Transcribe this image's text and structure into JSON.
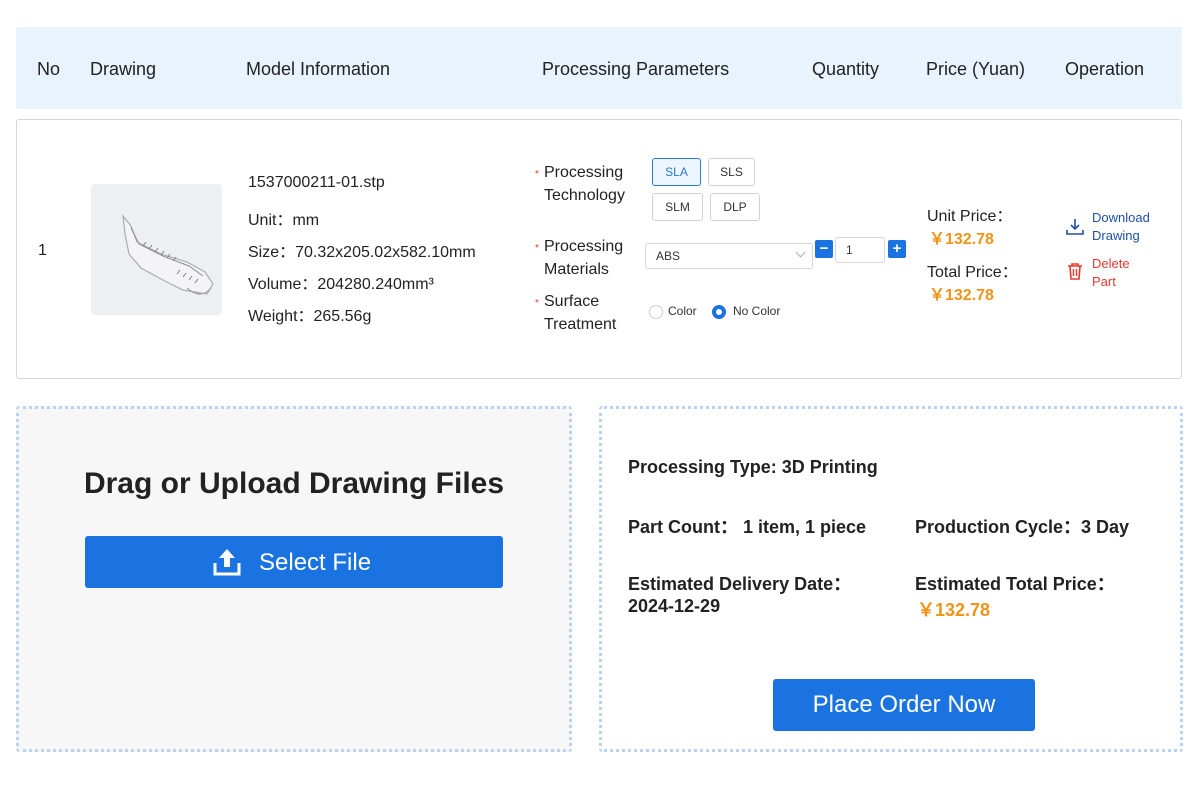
{
  "header": {
    "no": "No",
    "drawing": "Drawing",
    "model_info": "Model Information",
    "processing_params": "Processing Parameters",
    "quantity": "Quantity",
    "price": "Price (Yuan)",
    "operation": "Operation"
  },
  "part": {
    "no": "1",
    "filename": "1537000211-01.stp",
    "unit": "Unit：mm",
    "size": "Size：70.32x205.02x582.10mm",
    "volume": "Volume：204280.240mm³",
    "weight": "Weight：265.56g",
    "tech_label_1": "Processing",
    "tech_label_2": "Technology",
    "tech_options": [
      "SLA",
      "SLS",
      "SLM",
      "DLP"
    ],
    "tech_selected": "SLA",
    "material_label_1": "Processing",
    "material_label_2": "Materials",
    "material_value": "ABS",
    "surface_label_1": "Surface",
    "surface_label_2": "Treatment",
    "surface_options": [
      "Color",
      "No Color"
    ],
    "surface_selected": "No Color",
    "quantity": "1",
    "minus": "−",
    "plus": "+",
    "unit_price_label": "Unit Price：",
    "unit_price": "￥132.78",
    "total_price_label": "Total Price：",
    "total_price": "￥132.78",
    "download_label_1": "Download",
    "download_label_2": "Drawing",
    "delete_label_1": "Delete",
    "delete_label_2": "Part",
    "required_mark": "*"
  },
  "upload": {
    "title": "Drag or Upload Drawing Files",
    "button": "Select File"
  },
  "summary": {
    "processing_type": "Processing Type: 3D Printing",
    "part_count": "Part Count：  1 item, 1 piece",
    "production_cycle": "Production Cycle：3 Day",
    "delivery_label": "Estimated Delivery Date：",
    "delivery_date": "2024-12-29",
    "total_label": "Estimated Total Price：",
    "total_value": "￥132.78",
    "place_order": "Place Order Now"
  },
  "colors": {
    "accent": "#1a73e0",
    "price": "#f29317",
    "danger": "#e8382f",
    "link": "#1f4fa6",
    "header_bg": "#e8f3fd"
  },
  "icons": {
    "upload": "upload-icon",
    "download": "download-icon",
    "delete": "trash-icon",
    "dropdown": "chevron-down-icon"
  }
}
